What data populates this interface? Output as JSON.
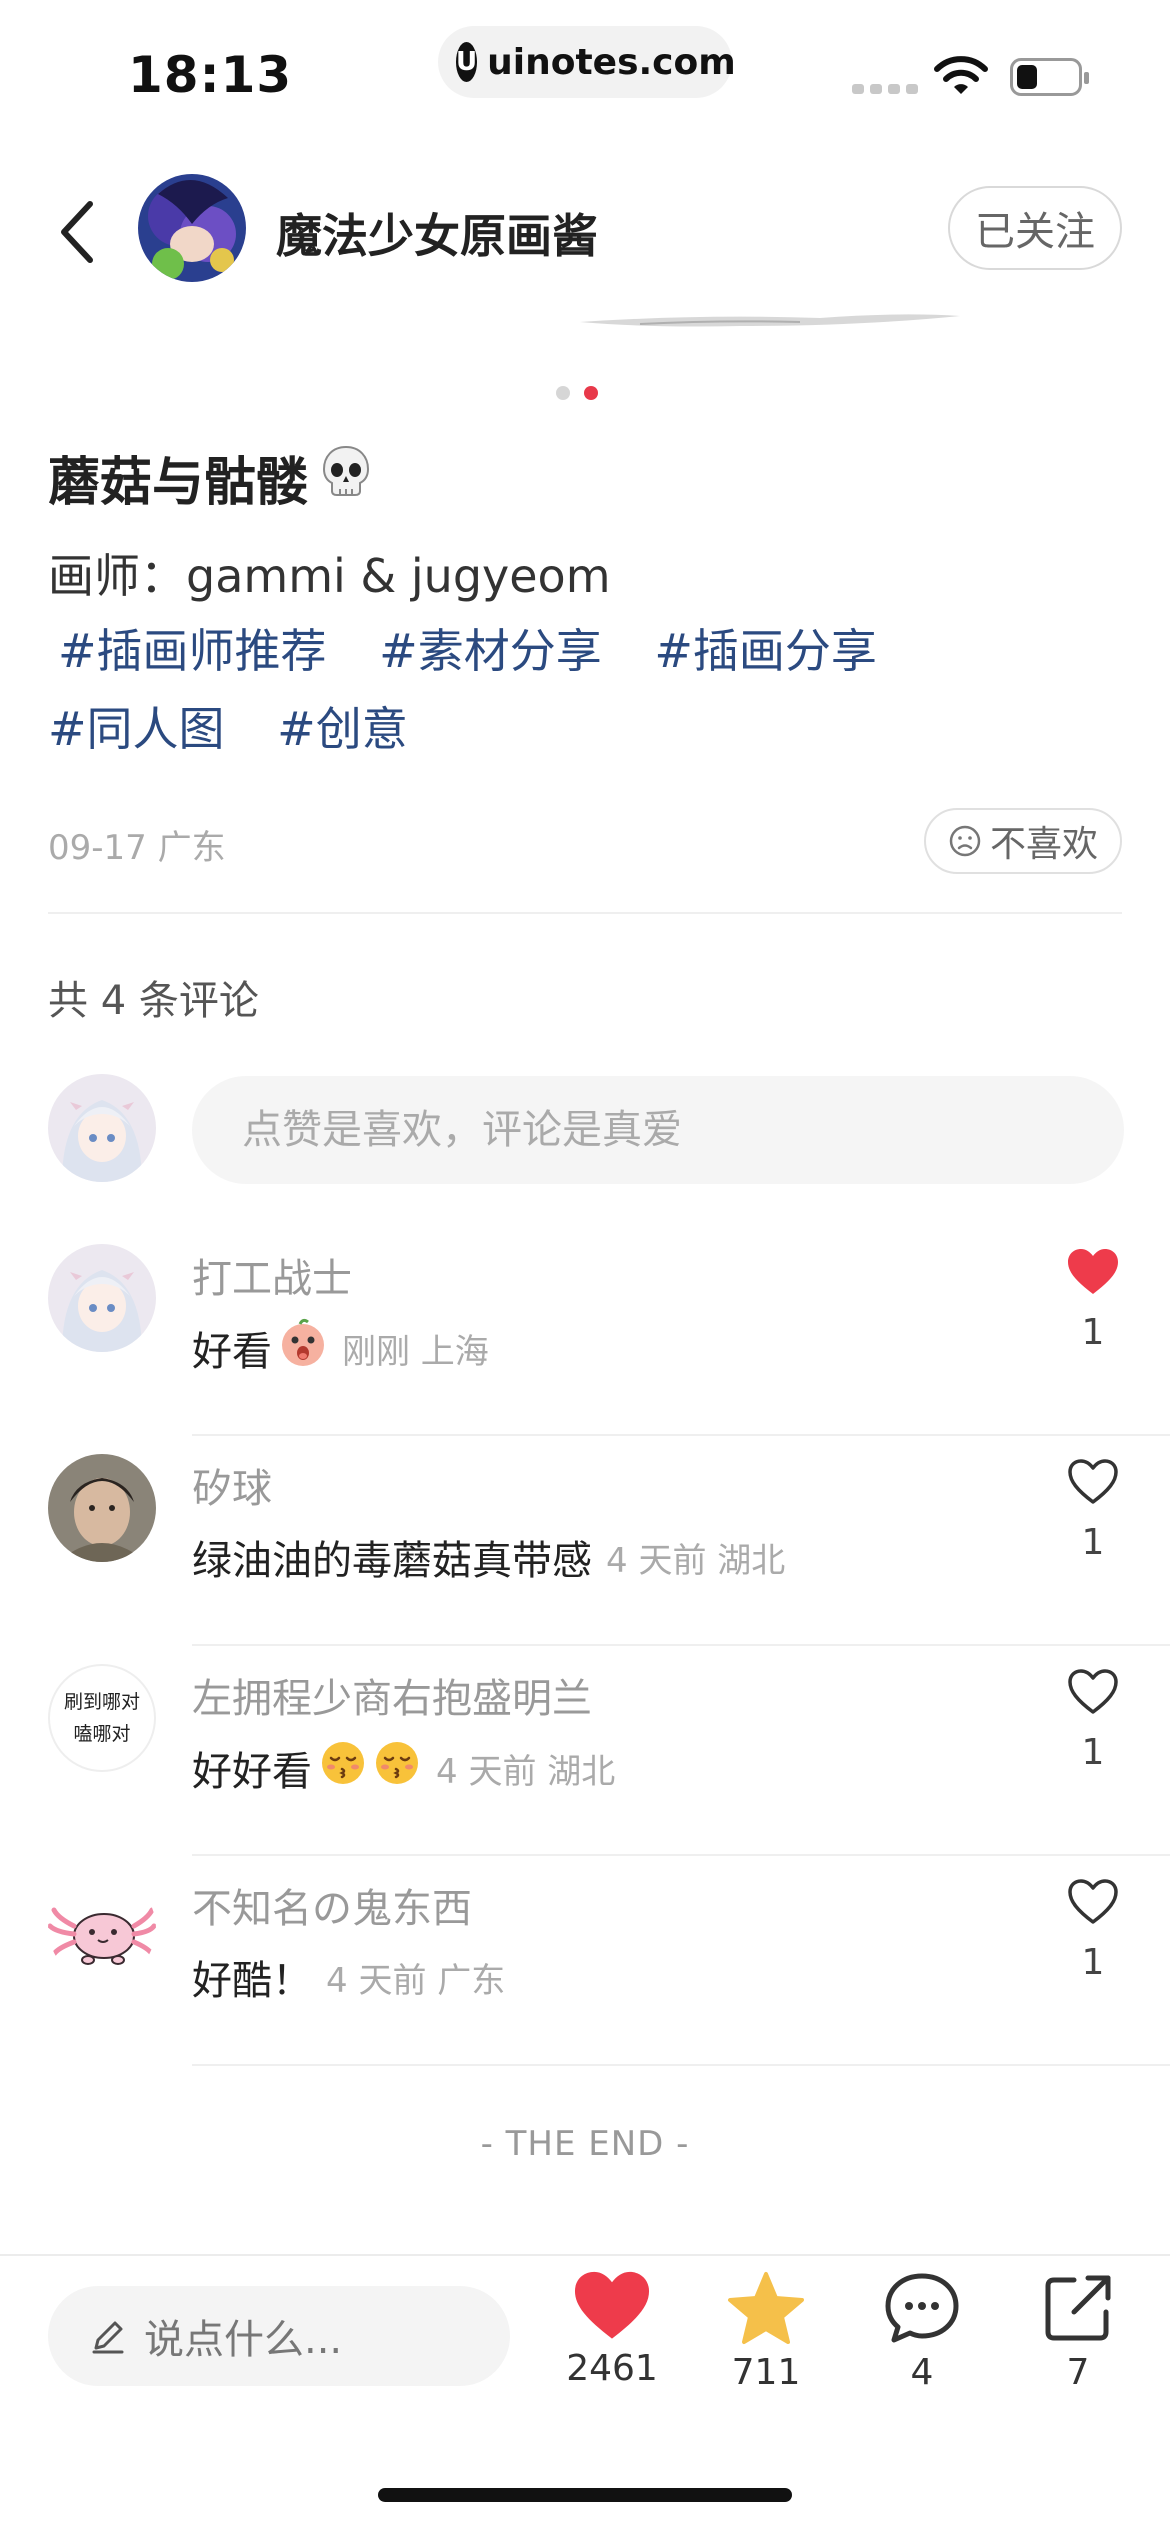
{
  "status_bar": {
    "time": "18:13",
    "url": "uinotes.com",
    "url_logo": "U"
  },
  "header": {
    "author_name": "魔法少女原画酱",
    "follow_label": "已关注"
  },
  "carousel": {
    "total": 2,
    "active_index": 1,
    "active_color": "#e8394a",
    "inactive_color": "#d6d6d6"
  },
  "post": {
    "title": "蘑菇与骷髅",
    "title_emoji": "💀",
    "description": "画师：gammi & jugyeom",
    "tags": [
      "#插画师推荐",
      "#素材分享",
      "#插画分享",
      "#同人图",
      "#创意"
    ],
    "date_location": "09-17 广东",
    "dislike_label": "不喜欢"
  },
  "comments_section": {
    "count_label": "共 4 条评论",
    "input_placeholder": "点赞是喜欢，评论是真爱",
    "items": [
      {
        "name": "打工战士",
        "text": "好看",
        "emoji": "😮",
        "meta": "刚刚 上海",
        "likes": "1",
        "liked": true
      },
      {
        "name": "矽球",
        "text": "绿油油的毒蘑菇真带感",
        "emoji": "",
        "meta": "4 天前 湖北",
        "likes": "1",
        "liked": false
      },
      {
        "name": "左拥程少商右抱盛明兰",
        "text": "好好看",
        "emoji": "😚😚",
        "meta": "4 天前 湖北",
        "likes": "1",
        "liked": false,
        "avatar_text": "刷到哪对\n嗑哪对"
      },
      {
        "name": "不知名の鬼东西",
        "text": "好酷！",
        "emoji": "",
        "meta": "4 天前 广东",
        "likes": "1",
        "liked": false
      }
    ],
    "end_label": "- THE END -"
  },
  "bottom_bar": {
    "input_placeholder": "说点什么...",
    "like_count": "2461",
    "star_count": "711",
    "comment_count": "4",
    "share_count": "7",
    "like_color": "#ee3b4b",
    "star_color": "#f5c04a"
  }
}
